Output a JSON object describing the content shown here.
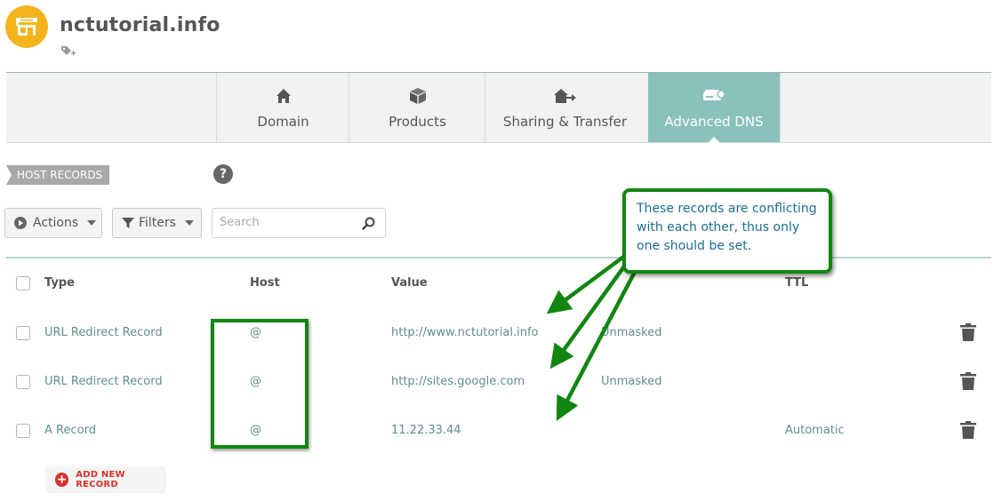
{
  "header": {
    "domain": "nctutorial.info"
  },
  "tabs": [
    {
      "label": "Domain",
      "icon": "home-icon"
    },
    {
      "label": "Products",
      "icon": "box-icon"
    },
    {
      "label": "Sharing & Transfer",
      "icon": "transfer-icon"
    },
    {
      "label": "Advanced DNS",
      "icon": "dns-server-icon",
      "active": true
    }
  ],
  "section": {
    "label": "HOST RECORDS",
    "help": "?"
  },
  "toolbar": {
    "actions_label": "Actions",
    "filters_label": "Filters",
    "search_placeholder": "Search"
  },
  "table": {
    "columns": [
      "Type",
      "Host",
      "Value",
      "TTL"
    ],
    "rows": [
      {
        "type": "URL Redirect Record",
        "host": "@",
        "value": "http://www.nctutorial.info",
        "extra": "Unmasked",
        "ttl": ""
      },
      {
        "type": "URL Redirect Record",
        "host": "@",
        "value": "http://sites.google.com",
        "extra": "Unmasked",
        "ttl": ""
      },
      {
        "type": "A Record",
        "host": "@",
        "value": "11.22.33.44",
        "extra": "",
        "ttl": "Automatic"
      }
    ]
  },
  "add_record_label": "ADD NEW RECORD",
  "annotation": {
    "text": "These records are conflicting with each other, thus only one should be set.",
    "color": "#118611"
  },
  "colors": {
    "accent": "#8ac1bd",
    "avatar": "#f3b41b",
    "danger": "#d8332b"
  }
}
